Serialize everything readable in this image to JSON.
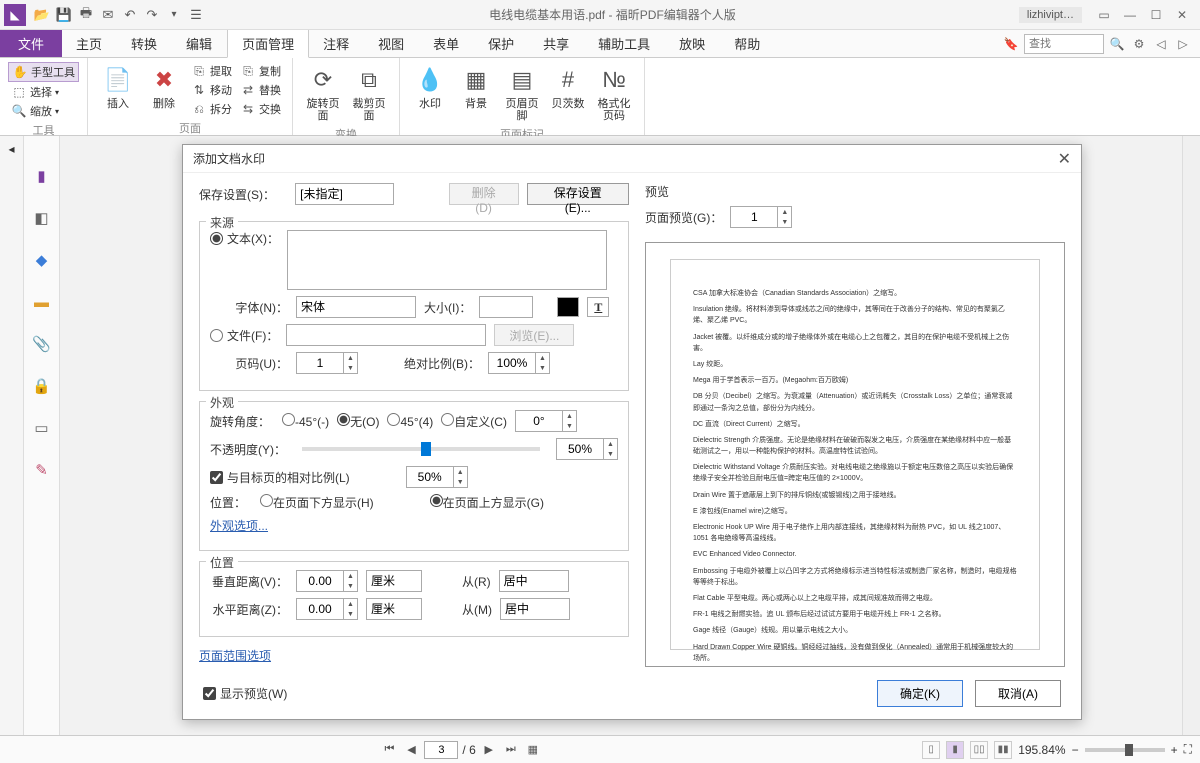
{
  "title": "电线电缆基本用语.pdf - 福昕PDF编辑器个人版",
  "user": "lizhivipt…",
  "menu": {
    "file": "文件",
    "tabs": [
      "主页",
      "转换",
      "编辑",
      "页面管理",
      "注释",
      "视图",
      "表单",
      "保护",
      "共享",
      "辅助工具",
      "放映",
      "帮助"
    ],
    "active_index": 3,
    "search_placeholder": "查找"
  },
  "ribbon": {
    "tools_group": "工具",
    "tools": {
      "hand": "手型工具",
      "select": "选择",
      "zoom": "缩放"
    },
    "page_group": "页面",
    "insert": "插入",
    "delete": "删除",
    "extract": "提取",
    "move": "移动",
    "split": "拆分",
    "copy": "复制",
    "replace": "替换",
    "swap": "交换",
    "transform_group": "变换",
    "rotate": "旋转页面",
    "crop": "裁剪页面",
    "mark_group": "页面标记",
    "watermark": "水印",
    "background": "背景",
    "header_footer": "页眉页脚",
    "bates": "贝茨数",
    "format_page": "格式化页码"
  },
  "dialog": {
    "title": "添加文档水印",
    "save_settings_label": "保存设置(S)：",
    "save_select": "[未指定]",
    "delete_btn": "删除(D)",
    "save_btn": "保存设置(E)...",
    "source_legend": "来源",
    "text_radio": "文本(X)：",
    "font_label": "字体(N)：",
    "font_value": "宋体",
    "size_label": "大小(I)：",
    "file_radio": "文件(F)：",
    "browse_btn": "浏览(E)...",
    "page_label": "页码(U)：",
    "page_value": "1",
    "abs_scale_label": "绝对比例(B)：",
    "abs_scale_value": "100%",
    "appearance_legend": "外观",
    "rotate_label": "旋转角度：",
    "rot_neg45": "-45°(-)",
    "rot_none": "无(O)",
    "rot_45": "45°(4)",
    "rot_custom": "自定义(C)",
    "rot_custom_val": "0°",
    "opacity_label": "不透明度(Y)：",
    "opacity_value": "50%",
    "rel_scale_check": "与目标页的相对比例(L)",
    "rel_scale_value": "50%",
    "position_label": "位置：",
    "pos_below": "在页面下方显示(H)",
    "pos_above": "在页面上方显示(G)",
    "appearance_link": "外观选项...",
    "position_legend": "位置",
    "vdist_label": "垂直距离(V)：",
    "vdist_value": "0.00",
    "vdist_unit": "厘米",
    "from_r": "从(R)",
    "vdist_from": "居中",
    "hdist_label": "水平距离(Z)：",
    "hdist_value": "0.00",
    "hdist_unit": "厘米",
    "from_m": "从(M)",
    "hdist_from": "居中",
    "page_range_link": "页面范围选项",
    "preview_legend": "预览",
    "page_preview_label": "页面预览(G)：",
    "page_preview_value": "1",
    "show_preview": "显示预览(W)",
    "ok": "确定(K)",
    "cancel": "取消(A)"
  },
  "preview_text": {
    "p1": "CSA  加拿大标准协会（Canadian Standards Association）之缩写。",
    "p2": "Insulation  绝缘。将材料渗到导体或线芯之间的绝缘中，其等同在于改善分子的结构、常见的有聚氯乙烯、聚乙烯 PVC。",
    "p3": "Jacket  被覆。以纤维成分或的增子绝缘体外或在电缆心上之包覆之，其目的在保护电缆不受机械上之伤害。",
    "p4": "Lay  绞距。",
    "p5": "Mega  用于学首表示一百万。(Megaohm:百万欧姆)",
    "p6": "DB  分贝（Decibel）之缩写。为衰减量（Attenuation）或近讯耗失（Crosstalk Loss）之单位；通常衰减即通过一条沟之总值，部份分为内线分。",
    "p7": "DC  直流（Direct Current）之缩写。",
    "p8": "Dielectric Strength  介质强度。无论是绝缘材料在破破而裂发之电压，介质强度在某绝缘材料中应一般基础测试之一，用以一种能构保护的材料。高温度特性试验间。",
    "p9": "Dielectric Withstand Voltage  介质耐压实验。对电线电缆之绝缘施以于额定电压数倍之高压以实验后确保绝缘子安全并检验且耐电压值=跨定电压值的 2×1000V。",
    "p10": "Drain Wire  置于遮蔽层上到下的排斥铜线(或镀锡线)之用于接地线。",
    "p11": "E  漆包线(Enamel wire)之缩写。",
    "p12": "Electronic Hook UP Wire  用于电子绝作上用内部连接线，其绝缘材料为耐热 PVC，如 UL 线之1007、1051 各电绝缘等高温线线。",
    "p13": "EVC  Enhanced Video Connector.",
    "p14": "Embossing  于电缆外被覆上以凸凹字之方式将绝缘标示进当特性标法或制造厂家名称，制造时，电缆规格等等终于标出。",
    "p15": "Flat Cable  平型电缆。两心或两心以上之电缆平排，成其间规准故而得之电缆。",
    "p16": "FR-1  电线之耐燃实验。追 UL 颁布后经过试试方要用于电缆开线上 FR-1 之名称。",
    "p17": "Gage 线径（Gauge）线规。用以量示电线之大小。",
    "p18": "Hard Drawn Copper Wire 硬铜线。铜经经过抽线，没有做到保化（Annealed）通常用于机械强度较大的场所。"
  },
  "status": {
    "page_current": "3",
    "page_total": "/ 6",
    "zoom": "195.84%"
  }
}
